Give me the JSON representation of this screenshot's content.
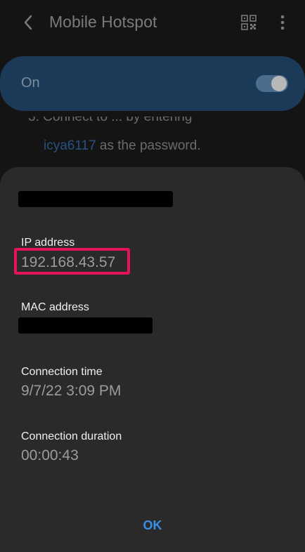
{
  "header": {
    "title": "Mobile Hotspot",
    "back_icon": "chevron-left-icon",
    "qr_icon": "qr-code-icon",
    "more_icon": "more-vert-icon"
  },
  "hotspot_toggle": {
    "label": "On",
    "state": "on"
  },
  "instructions": {
    "line1": "3. Connect to    ...    by entering",
    "password": "icya6117",
    "after_password": " as the password."
  },
  "dialog": {
    "ip_label": "IP address",
    "ip_value": "192.168.43.57",
    "mac_label": "MAC address",
    "conn_time_label": "Connection time",
    "conn_time_value": "9/7/22 3:09 PM",
    "conn_duration_label": "Connection duration",
    "conn_duration_value": "00:00:43",
    "ok_label": "OK"
  },
  "colors": {
    "accent": "#3a8ee6",
    "highlight": "#e5145a",
    "dialog_bg": "#2a2a2a",
    "toggle_card_bg": "#1b3a58"
  }
}
